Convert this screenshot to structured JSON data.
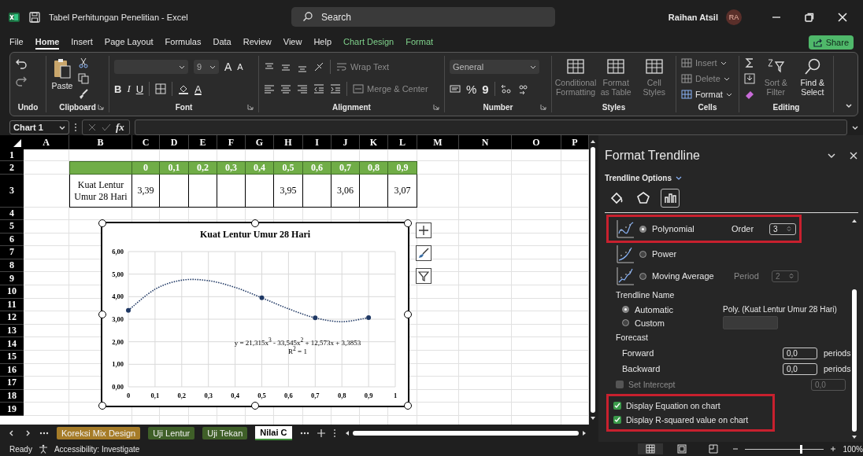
{
  "window": {
    "title": "Tabel Perhitungan Penelitian - Excel",
    "search": {
      "placeholder": "Search"
    },
    "user": {
      "name": "Raihan Atsil",
      "initials": "RA"
    }
  },
  "menu_tabs": [
    {
      "label": "File",
      "selected": false,
      "kind": "standard"
    },
    {
      "label": "Home",
      "selected": true,
      "kind": "standard"
    },
    {
      "label": "Insert",
      "selected": false,
      "kind": "standard"
    },
    {
      "label": "Page Layout",
      "selected": false,
      "kind": "standard"
    },
    {
      "label": "Formulas",
      "selected": false,
      "kind": "standard"
    },
    {
      "label": "Data",
      "selected": false,
      "kind": "standard"
    },
    {
      "label": "Review",
      "selected": false,
      "kind": "standard"
    },
    {
      "label": "View",
      "selected": false,
      "kind": "standard"
    },
    {
      "label": "Help",
      "selected": false,
      "kind": "standard"
    },
    {
      "label": "Chart Design",
      "selected": false,
      "kind": "contextual"
    },
    {
      "label": "Format",
      "selected": false,
      "kind": "contextual"
    }
  ],
  "share_button": "Share",
  "ribbon": {
    "groups": [
      {
        "kind": "undo",
        "label": "Undo"
      },
      {
        "kind": "clipboard",
        "label": "Clipboard",
        "paste": "Paste"
      },
      {
        "kind": "font",
        "label": "Font",
        "size": "9",
        "grow": "A",
        "shrink": "A",
        "bold": "B",
        "italic": "I",
        "underline": "U",
        "font_color": "A"
      },
      {
        "kind": "alignment",
        "label": "Alignment",
        "wrap": {
          "text": "Wrap Text",
          "disabled": true
        },
        "merge": {
          "text": "Merge & Center",
          "disabled": true
        }
      },
      {
        "kind": "number",
        "label": "Number",
        "format": "General",
        "percent": "%",
        "comma": "9"
      },
      {
        "kind": "styles",
        "label": "Styles",
        "buttons": [
          {
            "text": "Conditional Formatting",
            "disabled": true
          },
          {
            "text": "Format as Table",
            "disabled": true
          },
          {
            "text": "Cell Styles",
            "disabled": true
          }
        ]
      },
      {
        "kind": "cells",
        "label": "Cells",
        "buttons": [
          {
            "text": "Insert",
            "disabled": true
          },
          {
            "text": "Delete",
            "disabled": true
          },
          {
            "text": "Format",
            "disabled": false
          }
        ]
      },
      {
        "kind": "editing",
        "label": "Editing",
        "buttons": [
          {
            "text": "Sort & Filter",
            "disabled": true
          },
          {
            "text": "Find & Select",
            "disabled": false
          }
        ]
      }
    ]
  },
  "formula_bar": {
    "name_box": "Chart 1",
    "fx": "fx"
  },
  "sheet": {
    "columns": [
      "A",
      "B",
      "C",
      "D",
      "E",
      "F",
      "G",
      "H",
      "I",
      "J",
      "K",
      "L",
      "M",
      "N",
      "O",
      "P"
    ],
    "rows": [
      "1",
      "2",
      "3",
      "4",
      "5",
      "6",
      "7",
      "8",
      "9",
      "10",
      "11",
      "12",
      "13",
      "14",
      "15",
      "16",
      "17",
      "18",
      "19"
    ],
    "data_table": {
      "header_cells": [
        "0",
        "0,1",
        "0,2",
        "0,3",
        "0,4",
        "0,5",
        "0,6",
        "0,7",
        "0,8",
        "0,9"
      ],
      "row_label": "Kuat Lentur Umur 28 Hari",
      "cells": [
        {
          "kind": "value",
          "text": "3,39"
        },
        {
          "kind": "empty"
        },
        {
          "kind": "empty"
        },
        {
          "kind": "empty"
        },
        {
          "kind": "empty"
        },
        {
          "kind": "value",
          "text": "3,95"
        },
        {
          "kind": "empty"
        },
        {
          "kind": "value",
          "text": "3,06"
        },
        {
          "kind": "empty"
        },
        {
          "kind": "value",
          "text": "3,07"
        }
      ]
    },
    "chart": {
      "selected": true,
      "chart_data": {
        "type": "scatter",
        "title": "Kuat Lentur Umur 28 Hari",
        "x": [
          0,
          0.1,
          0.2,
          0.3,
          0.4,
          0.5,
          0.6,
          0.7,
          0.8,
          0.9
        ],
        "series": [
          {
            "type": "scatter",
            "color": "#1f3864",
            "values": [
              3.39,
              null,
              null,
              null,
              null,
              3.95,
              null,
              3.06,
              null,
              3.07
            ]
          },
          {
            "type": "line",
            "line_style": "dotted",
            "color": "#1f3864",
            "values": [
              3.39,
              4.33,
              4.73,
              4.71,
              4.41,
              3.95,
              3.46,
              3.06,
              2.89,
              3.07
            ]
          }
        ],
        "xlim": [
          0,
          1
        ],
        "ylim": [
          0,
          6
        ],
        "grid": true,
        "xticks": [
          {
            "value": 0,
            "label": "0"
          },
          {
            "value": 0.1,
            "label": "0,1"
          },
          {
            "value": 0.2,
            "label": "0,2"
          },
          {
            "value": 0.3,
            "label": "0,3"
          },
          {
            "value": 0.4,
            "label": "0,4"
          },
          {
            "value": 0.5,
            "label": "0,5"
          },
          {
            "value": 0.6,
            "label": "0,6"
          },
          {
            "value": 0.7,
            "label": "0,7"
          },
          {
            "value": 0.8,
            "label": "0,8"
          },
          {
            "value": 0.9,
            "label": "0,9"
          },
          {
            "value": 1,
            "label": "1"
          }
        ],
        "yticks": [
          {
            "value": 0,
            "label": "0,00"
          },
          {
            "value": 1,
            "label": "1,00"
          },
          {
            "value": 2,
            "label": "2,00"
          },
          {
            "value": 3,
            "label": "3,00"
          },
          {
            "value": 4,
            "label": "4,00"
          },
          {
            "value": 5,
            "label": "5,00"
          },
          {
            "value": 6,
            "label": "6,00"
          }
        ],
        "annotations": [
          "y = 21,315x$^{3}$ - 33,545x$^{2}$ + 12,573x + 3,3853",
          "R$^{2}$ = 1"
        ]
      }
    }
  },
  "format_panel": {
    "title": "Format Trendline",
    "section": "Trendline Options",
    "tabs": [
      {
        "kind": "fill",
        "selected": false
      },
      {
        "kind": "effects",
        "selected": false
      },
      {
        "kind": "options",
        "selected": true
      }
    ],
    "trendline_types": [
      {
        "label": "Polynomial",
        "selected": true,
        "highlighted": true,
        "param_label": "Order",
        "param_value": "3",
        "param_disabled": false
      },
      {
        "label": "Power",
        "selected": false,
        "highlighted": false
      },
      {
        "label": "Moving Average",
        "selected": false,
        "highlighted": false,
        "param_label": "Period",
        "param_value": "2",
        "param_disabled": true
      }
    ],
    "name_section": {
      "heading": "Trendline Name",
      "options": [
        {
          "label": "Automatic",
          "selected": true,
          "kind": "text",
          "value": "Poly. (Kuat Lentur Umur 28 Hari)"
        },
        {
          "label": "Custom",
          "selected": false,
          "kind": "field"
        }
      ]
    },
    "forecast": {
      "heading": "Forecast",
      "rows": [
        {
          "label": "Forward",
          "value": "0,0",
          "unit": "periods"
        },
        {
          "label": "Backward",
          "value": "0,0",
          "unit": "periods"
        }
      ]
    },
    "intercept": {
      "label": "Set Intercept",
      "checked": false,
      "disabled": true,
      "value": "0,0"
    },
    "display_options": {
      "highlighted": true,
      "items": [
        {
          "label": "Display Equation on chart",
          "checked": true
        },
        {
          "label": "Display R-squared value on chart",
          "checked": true
        }
      ]
    }
  },
  "sheet_tabs": [
    {
      "label": "Koreksi Mix Design",
      "selected": false,
      "color": "#a67c28"
    },
    {
      "label": "Uji Lentur",
      "selected": false,
      "color": "#3f5f28"
    },
    {
      "label": "Uji Tekan",
      "selected": false,
      "color": "#3f5f28"
    },
    {
      "label": "Nilai C",
      "selected": true,
      "color": "#3f8f3a"
    }
  ],
  "status_bar": {
    "status": "Ready",
    "accessibility": "Accessibility: Investigate",
    "views": [
      {
        "kind": "normal",
        "selected": true
      },
      {
        "kind": "page-layout",
        "selected": false
      },
      {
        "kind": "page-break",
        "selected": false
      }
    ],
    "zoom": {
      "level": 0.7,
      "reading": "100%"
    }
  }
}
